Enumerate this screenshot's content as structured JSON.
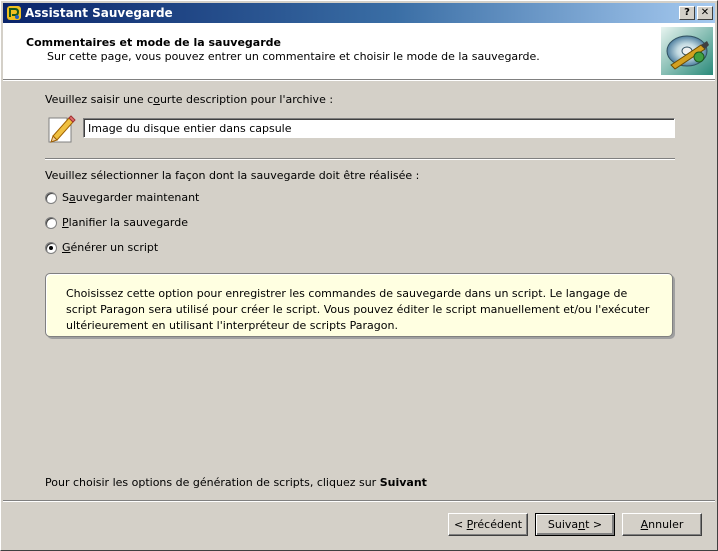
{
  "window": {
    "title": "Assistant Sauvegarde",
    "help_glyph": "?",
    "close_glyph": "✕"
  },
  "header": {
    "title": "Commentaires et mode de la sauvegarde",
    "subtitle": "Sur cette page, vous pouvez entrer un commentaire et choisir le mode de la sauvegarde."
  },
  "description": {
    "label_before": "Veuillez saisir une c",
    "label_hotkey": "o",
    "label_after": "urte description pour l'archive :",
    "value": "Image du disque entier dans capsule"
  },
  "mode": {
    "label": "Veuillez sélectionner la façon dont la sauvegarde doit être réalisée :",
    "options": [
      {
        "pre": "S",
        "hotkey": "a",
        "post": "uvegarder maintenant",
        "checked": false
      },
      {
        "pre": "",
        "hotkey": "P",
        "post": "lanifier la sauvegarde",
        "checked": false
      },
      {
        "pre": "",
        "hotkey": "G",
        "post": "énérer un script",
        "checked": true
      }
    ]
  },
  "info_text": "Choisissez cette option pour enregistrer les commandes de sauvegarde dans un script. Le langage de script Paragon sera utilisé pour créer le script. Vous pouvez éditer le script manuellement et/ou l'exécuter ultérieurement en utilisant l'interpréteur de scripts Paragon.",
  "footer": {
    "hint_prefix": "Pour choisir les options de génération de scripts, cliquez sur ",
    "hint_bold": "Suivant"
  },
  "buttons": {
    "prev": {
      "pre": "< ",
      "hotkey": "P",
      "post": "récédent"
    },
    "next": {
      "pre": "Suiva",
      "hotkey": "n",
      "post": "t >"
    },
    "cancel": {
      "pre": "",
      "hotkey": "A",
      "post": "nnuler"
    }
  }
}
